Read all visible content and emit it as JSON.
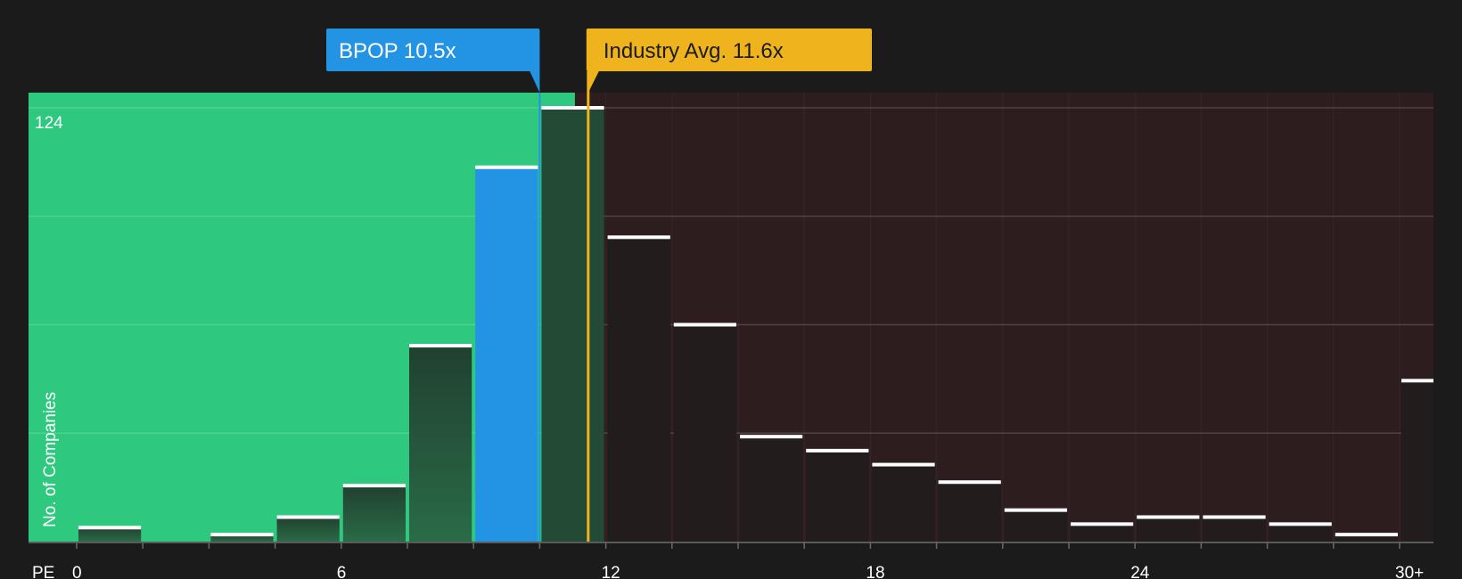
{
  "chart_data": {
    "type": "bar",
    "xlabel": "PE",
    "ylabel": "No. of Companies",
    "xlim": [
      0,
      31.5
    ],
    "ylim": [
      0,
      124
    ],
    "y_max_label": "124",
    "grid": true,
    "x_ticks": [
      {
        "value": 0,
        "label": "0"
      },
      {
        "value": 6,
        "label": "6"
      },
      {
        "value": 12,
        "label": "12"
      },
      {
        "value": 18,
        "label": "18"
      },
      {
        "value": 24,
        "label": "24"
      },
      {
        "value": 30,
        "label": "30+"
      }
    ],
    "bin_width": 1.5,
    "bins": [
      {
        "start": 0,
        "value": 4
      },
      {
        "start": 1.5,
        "value": 0
      },
      {
        "start": 3,
        "value": 2
      },
      {
        "start": 4.5,
        "value": 7
      },
      {
        "start": 6,
        "value": 16
      },
      {
        "start": 7.5,
        "value": 56
      },
      {
        "start": 9,
        "value": 107,
        "highlight": true
      },
      {
        "start": 10.5,
        "value": 124
      },
      {
        "start": 12,
        "value": 87
      },
      {
        "start": 13.5,
        "value": 62
      },
      {
        "start": 15,
        "value": 30
      },
      {
        "start": 16.5,
        "value": 26
      },
      {
        "start": 18,
        "value": 22
      },
      {
        "start": 19.5,
        "value": 17
      },
      {
        "start": 21,
        "value": 9
      },
      {
        "start": 22.5,
        "value": 5
      },
      {
        "start": 24,
        "value": 7
      },
      {
        "start": 25.5,
        "value": 7
      },
      {
        "start": 27,
        "value": 5
      },
      {
        "start": 28.5,
        "value": 2
      },
      {
        "start": 30,
        "value": 46
      }
    ],
    "company": {
      "label": "BPOP 10.5x",
      "value": 10.5
    },
    "industry_avg": {
      "label": "Industry Avg. 11.6x",
      "value": 11.6
    },
    "good_zone_end": 11.3,
    "colors": {
      "background": "#1b1b1b",
      "good_zone": "#2ec97e",
      "bad_zone": "#2e1d1f",
      "highlight_bar": "#2394e3",
      "company_marker": "#2394e3",
      "industry_marker": "#eeb31d",
      "bar_top": "#ffffff"
    }
  }
}
